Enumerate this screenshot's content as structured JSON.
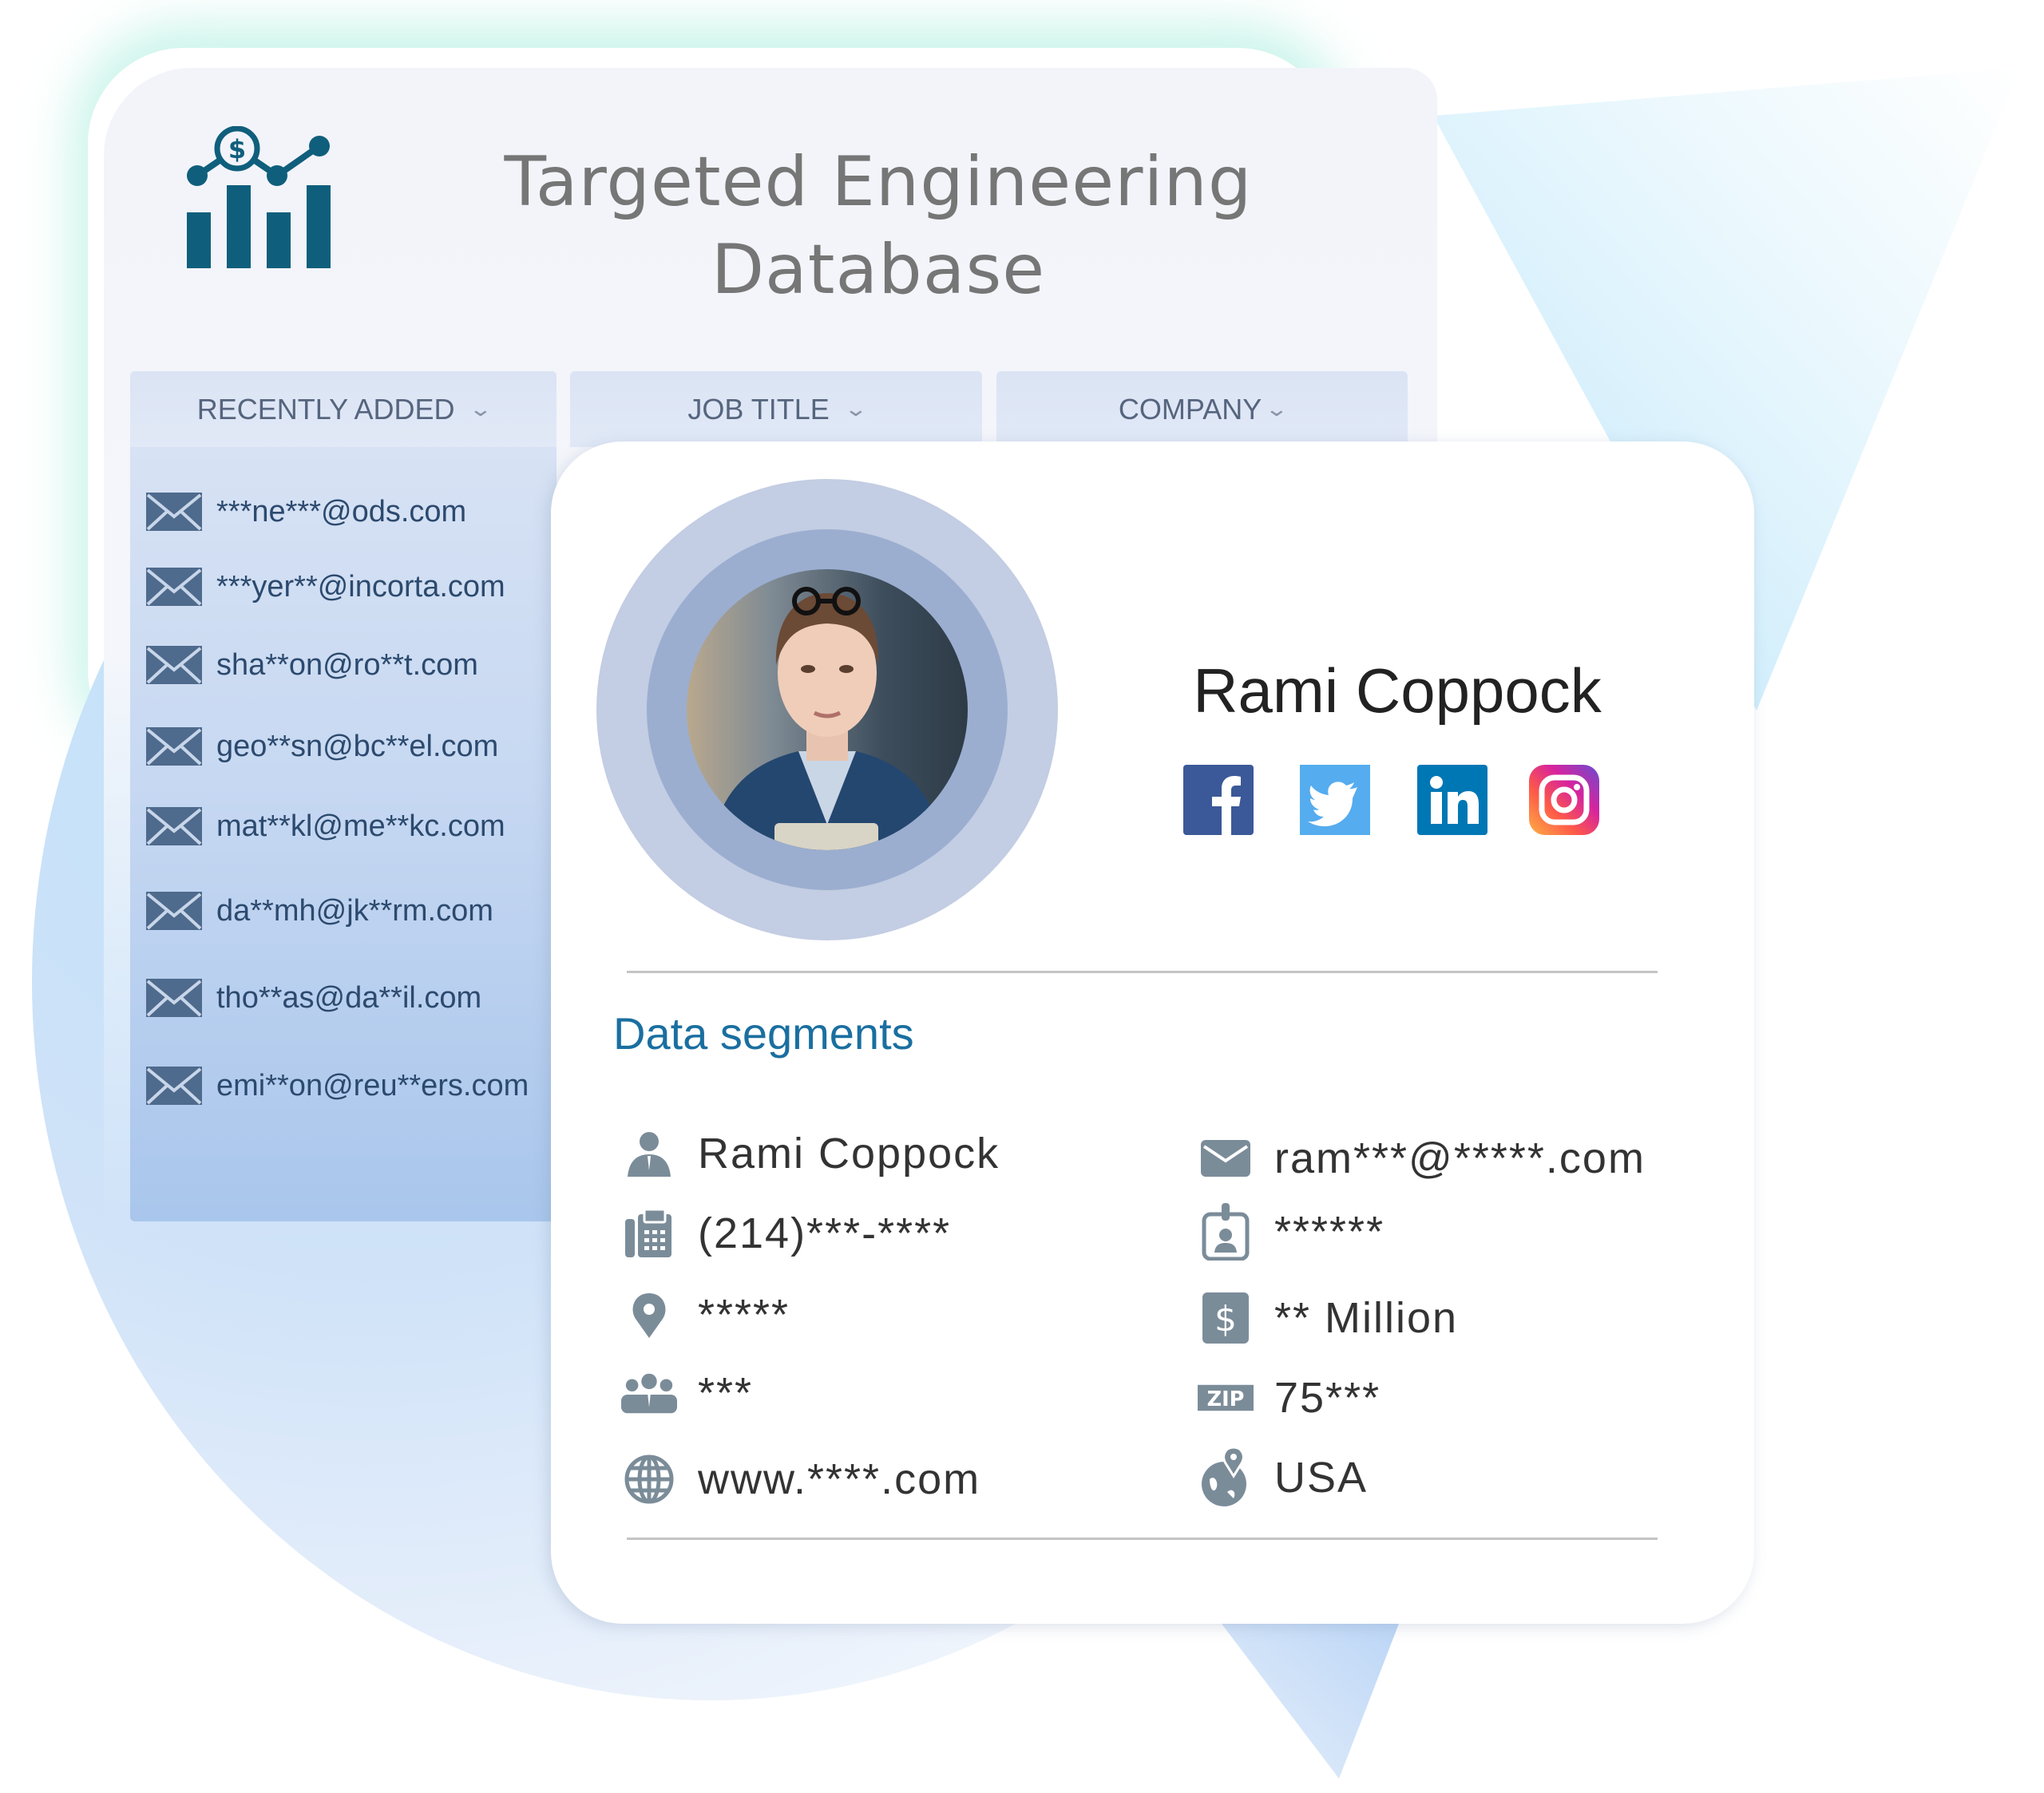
{
  "header": {
    "title_line1": "Targeted Engineering",
    "title_line2": "Database",
    "logo_icon": "chart-dollar-icon"
  },
  "filters": [
    {
      "label": "RECENTLY ADDED",
      "icon": "chevron-down-icon"
    },
    {
      "label": "JOB TITLE",
      "icon": "chevron-down-icon"
    },
    {
      "label": "COMPANY",
      "icon": "chevron-down-icon"
    }
  ],
  "recent_emails": [
    "***ne***@ods.com",
    "***yer**@incorta.com",
    "sha**on@ro**t.com",
    "geo**sn@bc**el.com",
    "mat**kl@me**kc.com",
    "da**mh@jk**rm.com",
    "tho**as@da**il.com",
    "emi**on@reu**ers.com"
  ],
  "profile": {
    "name": "Rami Coppock",
    "avatar": "profile-photo",
    "social": [
      {
        "name": "facebook",
        "glyph": "f",
        "color": "#3b5998"
      },
      {
        "name": "twitter",
        "glyph": "t",
        "color": "#55acee"
      },
      {
        "name": "linkedin",
        "glyph": "in",
        "color": "#0077b5"
      },
      {
        "name": "instagram",
        "glyph": "ig",
        "color": "#e1306c"
      }
    ]
  },
  "segments": {
    "title": "Data segments",
    "left": [
      {
        "icon": "person-icon",
        "value": "Rami Coppock"
      },
      {
        "icon": "phone-icon",
        "value": "(214)***-****"
      },
      {
        "icon": "location-pin-icon",
        "value": "*****"
      },
      {
        "icon": "team-icon",
        "value": "***"
      },
      {
        "icon": "globe-icon",
        "value": "www.****.com"
      }
    ],
    "right": [
      {
        "icon": "mail-icon",
        "value": "ram***@*****.com"
      },
      {
        "icon": "id-badge-icon",
        "value": "******"
      },
      {
        "icon": "dollar-icon",
        "value": "** Million"
      },
      {
        "icon": "zip-icon",
        "value": "75***",
        "badge": "ZIP"
      },
      {
        "icon": "world-pin-icon",
        "value": "USA"
      }
    ]
  },
  "colors": {
    "accent": "#1a6fa0",
    "logo": "#0f5f7c",
    "icon_gray": "#7b8c99",
    "email_text": "#2c4a6e"
  }
}
